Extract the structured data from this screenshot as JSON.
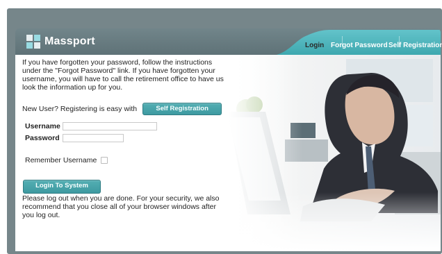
{
  "app": {
    "brand": "Massport"
  },
  "nav": {
    "items": [
      {
        "label": "Login",
        "active": true
      },
      {
        "label": "Forgot Password",
        "active": false
      },
      {
        "label": "Self Registration",
        "active": false
      }
    ]
  },
  "main": {
    "intro": "If you have forgotten your password, follow the instructions under the \"Forgot Password\" link.  If you have forgotten your username, you will have to call the retirement office to have us look the information up for you.",
    "new_user_text": "New User?  Registering is easy with",
    "self_registration_button": "Self Registration",
    "username_label": "Username",
    "username_value": "",
    "password_label": "Password",
    "password_value": "",
    "remember_label": "Remember Username",
    "remember_checked": false,
    "login_button": "Login To System",
    "logout_text": "Please log out when you are done.  For your security, we also recommend that you close all of your browser windows after you log out."
  },
  "colors": {
    "frame": "#76868a",
    "header": "#6b7d82",
    "accent": "#46a5ac",
    "text": "#1f1f1f"
  }
}
